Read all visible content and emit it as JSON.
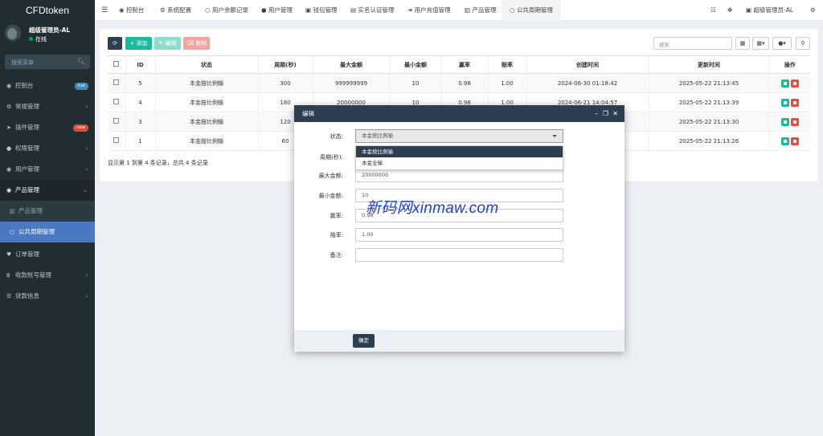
{
  "brand": "CFDtoken",
  "user": {
    "name": "超级管理员-AL",
    "status": "在线"
  },
  "sidebar": {
    "search_placeholder": "搜索菜单",
    "items": [
      {
        "label": "控制台",
        "icon": "dashboard-icon",
        "badge": "hot",
        "badge_color": "#3c8dbc"
      },
      {
        "label": "常规管理",
        "icon": "cogs-icon"
      },
      {
        "label": "插件管理",
        "icon": "rocket-icon",
        "badge": "new",
        "badge_color": "#dd4b39"
      },
      {
        "label": "权限管理",
        "icon": "group-icon"
      },
      {
        "label": "用户管理",
        "icon": "user-circle-icon"
      },
      {
        "label": "产品管理",
        "icon": "product-icon"
      },
      {
        "label": "产品管理",
        "icon": "product-sub-icon"
      },
      {
        "label": "公共周期管理",
        "icon": "circle-icon"
      },
      {
        "label": "订单管理",
        "icon": "heart-icon"
      },
      {
        "label": "收款账号管理",
        "icon": "bitcoin-icon"
      },
      {
        "label": "贷款信息",
        "icon": "list-icon"
      }
    ]
  },
  "topnav": {
    "tabs": [
      "控制台",
      "系统配置",
      "用户余额记录",
      "用户管理",
      "钱包管理",
      "实名认证管理",
      "用户充值管理",
      "产品管理",
      "公共周期管理"
    ],
    "admin": "超级管理员-AL"
  },
  "toolbar": {
    "add": "添加",
    "edit": "编辑",
    "delete": "删除",
    "search_placeholder": "搜索"
  },
  "table": {
    "columns": [
      "ID",
      "状态",
      "周期(秒)",
      "最大金额",
      "最小金额",
      "赢率",
      "赔率",
      "创建时间",
      "更新时间",
      "操作"
    ],
    "rows": [
      {
        "id": "5",
        "status": "本金按比例输",
        "period": "300",
        "max": "999999999",
        "min": "10",
        "win": "0.98",
        "lose": "1.00",
        "created": "2024-06-30 01:18:42",
        "updated": "2025-05-22 21:13:45"
      },
      {
        "id": "4",
        "status": "本金按比例输",
        "period": "180",
        "max": "20000000",
        "min": "10",
        "win": "0.98",
        "lose": "1.00",
        "created": "2024-06-21 14:04:57",
        "updated": "2025-05-22 21:13:39"
      },
      {
        "id": "3",
        "status": "本金按比例输",
        "period": "120",
        "max": "",
        "min": "",
        "win": "",
        "lose": "",
        "created": "",
        "updated": "2025-05-22 21:13:30"
      },
      {
        "id": "1",
        "status": "本金按比例输",
        "period": "60",
        "max": "",
        "min": "",
        "win": "",
        "lose": "",
        "created": "",
        "updated": "2025-05-22 21:13:26"
      }
    ],
    "pageinfo": "显示第 1 到第 4 条记录，总共 4 条记录"
  },
  "modal": {
    "title": "编辑",
    "fields": {
      "status_label": "状态:",
      "status_value": "本金按比例输",
      "period_label": "周期(秒):",
      "max_label": "最大金额:",
      "max_value": "20000000",
      "min_label": "最小金额:",
      "min_value": "10",
      "win_label": "赢率:",
      "win_value": "0.98",
      "lose_label": "赔率:",
      "lose_value": "1.00",
      "remark_label": "备注:",
      "remark_value": ""
    },
    "dropdown_options": [
      "本金按比例输",
      "本金全输"
    ],
    "ok": "确定"
  },
  "watermark": "新码网xinmaw.com"
}
